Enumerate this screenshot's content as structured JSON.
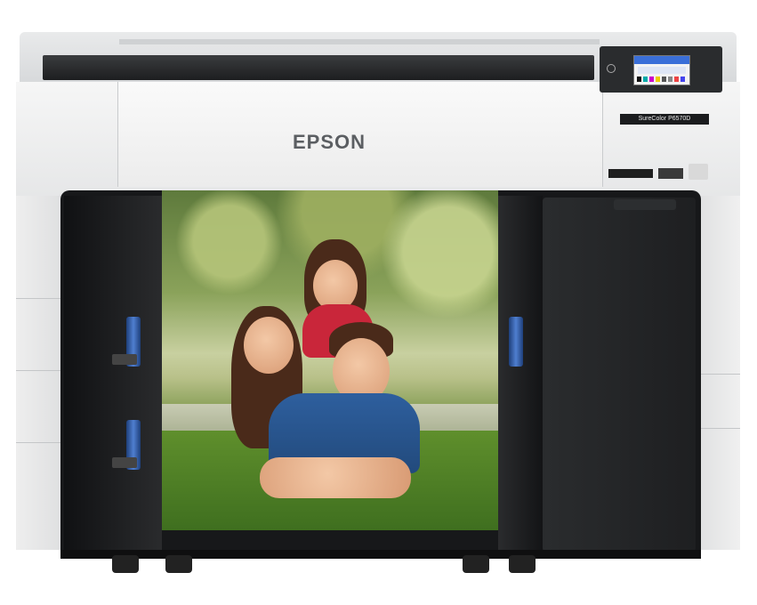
{
  "brand": "EPSON",
  "model_label": "SureColor P6570D",
  "photo": {
    "icon": "family-photo-icon"
  },
  "colors": {
    "body": "#e6e7e8",
    "dark": "#17181a",
    "roll_blue": "#3b6cc0",
    "screen_accent": "#3a6fd8"
  }
}
